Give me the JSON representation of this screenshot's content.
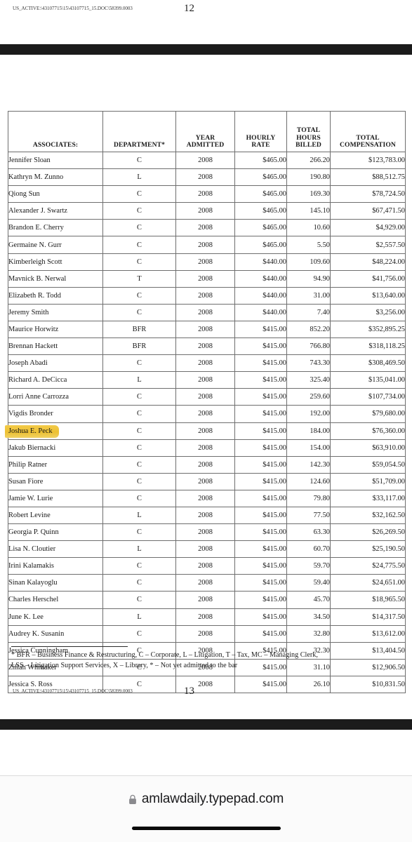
{
  "document": {
    "header_slug": "US_ACTIVE:\\43107715\\15\\43107715_15.DOC\\58399.0003",
    "header_page_number": "12",
    "footer_slug": "US_ACTIVE:\\43107715\\15\\43107715_15.DOC\\58399.0003",
    "footer_page_number": "13",
    "footnote_line1": "* BFR – Business Finance & Restructuring,  C – Corporate,  L – Litigation,  T – Tax,  MC –  Managing Clerk,",
    "footnote_line2": "LSS – Litigation Support Services,  X – Library,  * – Not yet admitted to the bar"
  },
  "table": {
    "columns": [
      {
        "key": "name",
        "label": "ASSOCIATES:",
        "lines": [
          "ASSOCIATES:"
        ]
      },
      {
        "key": "dept",
        "label": "DEPARTMENT*",
        "lines": [
          "DEPARTMENT*"
        ]
      },
      {
        "key": "year",
        "label": "YEAR ADMITTED",
        "lines": [
          "YEAR",
          "ADMITTED"
        ]
      },
      {
        "key": "rate",
        "label": "HOURLY RATE",
        "lines": [
          "HOURLY",
          "RATE"
        ]
      },
      {
        "key": "hours",
        "label": "TOTAL HOURS BILLED",
        "lines": [
          "TOTAL",
          "HOURS",
          "BILLED"
        ]
      },
      {
        "key": "comp",
        "label": "TOTAL COMPENSATION",
        "lines": [
          "TOTAL",
          "COMPENSATION"
        ]
      }
    ],
    "highlight_color": "#edc132",
    "highlighted_row_name": "Joshua E. Peck",
    "rows": [
      {
        "name": "Jennifer Sloan",
        "dept": "C",
        "year": "2008",
        "rate": "$465.00",
        "hours": "266.20",
        "comp": "$123,783.00",
        "highlight": false
      },
      {
        "name": "Kathryn M. Zunno",
        "dept": "L",
        "year": "2008",
        "rate": "$465.00",
        "hours": "190.80",
        "comp": "$88,512.75",
        "highlight": false
      },
      {
        "name": "Qiong Sun",
        "dept": "C",
        "year": "2008",
        "rate": "$465.00",
        "hours": "169.30",
        "comp": "$78,724.50",
        "highlight": false
      },
      {
        "name": "Alexander J. Swartz",
        "dept": "C",
        "year": "2008",
        "rate": "$465.00",
        "hours": "145.10",
        "comp": "$67,471.50",
        "highlight": false
      },
      {
        "name": "Brandon E. Cherry",
        "dept": "C",
        "year": "2008",
        "rate": "$465.00",
        "hours": "10.60",
        "comp": "$4,929.00",
        "highlight": false
      },
      {
        "name": "Germaine N. Gurr",
        "dept": "C",
        "year": "2008",
        "rate": "$465.00",
        "hours": "5.50",
        "comp": "$2,557.50",
        "highlight": false
      },
      {
        "name": "Kimberleigh Scott",
        "dept": "C",
        "year": "2008",
        "rate": "$440.00",
        "hours": "109.60",
        "comp": "$48,224.00",
        "highlight": false
      },
      {
        "name": "Mavnick B. Nerwal",
        "dept": "T",
        "year": "2008",
        "rate": "$440.00",
        "hours": "94.90",
        "comp": "$41,756.00",
        "highlight": false
      },
      {
        "name": "Elizabeth R. Todd",
        "dept": "C",
        "year": "2008",
        "rate": "$440.00",
        "hours": "31.00",
        "comp": "$13,640.00",
        "highlight": false
      },
      {
        "name": "Jeremy Smith",
        "dept": "C",
        "year": "2008",
        "rate": "$440.00",
        "hours": "7.40",
        "comp": "$3,256.00",
        "highlight": false
      },
      {
        "name": "Maurice Horwitz",
        "dept": "BFR",
        "year": "2008",
        "rate": "$415.00",
        "hours": "852.20",
        "comp": "$352,895.25",
        "highlight": false
      },
      {
        "name": "Brennan Hackett",
        "dept": "BFR",
        "year": "2008",
        "rate": "$415.00",
        "hours": "766.80",
        "comp": "$318,118.25",
        "highlight": false
      },
      {
        "name": "Joseph Abadi",
        "dept": "C",
        "year": "2008",
        "rate": "$415.00",
        "hours": "743.30",
        "comp": "$308,469.50",
        "highlight": false
      },
      {
        "name": "Richard A. DeCicca",
        "dept": "L",
        "year": "2008",
        "rate": "$415.00",
        "hours": "325.40",
        "comp": "$135,041.00",
        "highlight": false
      },
      {
        "name": "Lorri Anne Carrozza",
        "dept": "C",
        "year": "2008",
        "rate": "$415.00",
        "hours": "259.60",
        "comp": "$107,734.00",
        "highlight": false
      },
      {
        "name": "Vigdis Bronder",
        "dept": "C",
        "year": "2008",
        "rate": "$415.00",
        "hours": "192.00",
        "comp": "$79,680.00",
        "highlight": false
      },
      {
        "name": "Joshua E. Peck",
        "dept": "C",
        "year": "2008",
        "rate": "$415.00",
        "hours": "184.00",
        "comp": "$76,360.00",
        "highlight": true
      },
      {
        "name": "Jakub Biernacki",
        "dept": "C",
        "year": "2008",
        "rate": "$415.00",
        "hours": "154.00",
        "comp": "$63,910.00",
        "highlight": false
      },
      {
        "name": "Philip Ratner",
        "dept": "C",
        "year": "2008",
        "rate": "$415.00",
        "hours": "142.30",
        "comp": "$59,054.50",
        "highlight": false
      },
      {
        "name": "Susan Fiore",
        "dept": "C",
        "year": "2008",
        "rate": "$415.00",
        "hours": "124.60",
        "comp": "$51,709.00",
        "highlight": false
      },
      {
        "name": "Jamie W. Lurie",
        "dept": "C",
        "year": "2008",
        "rate": "$415.00",
        "hours": "79.80",
        "comp": "$33,117.00",
        "highlight": false
      },
      {
        "name": "Robert Levine",
        "dept": "L",
        "year": "2008",
        "rate": "$415.00",
        "hours": "77.50",
        "comp": "$32,162.50",
        "highlight": false
      },
      {
        "name": "Georgia P. Quinn",
        "dept": "C",
        "year": "2008",
        "rate": "$415.00",
        "hours": "63.30",
        "comp": "$26,269.50",
        "highlight": false
      },
      {
        "name": "Lisa N. Cloutier",
        "dept": "L",
        "year": "2008",
        "rate": "$415.00",
        "hours": "60.70",
        "comp": "$25,190.50",
        "highlight": false
      },
      {
        "name": "Irini Kalamakis",
        "dept": "C",
        "year": "2008",
        "rate": "$415.00",
        "hours": "59.70",
        "comp": "$24,775.50",
        "highlight": false
      },
      {
        "name": "Sinan Kalayoglu",
        "dept": "C",
        "year": "2008",
        "rate": "$415.00",
        "hours": "59.40",
        "comp": "$24,651.00",
        "highlight": false
      },
      {
        "name": "Charles Herschel",
        "dept": "C",
        "year": "2008",
        "rate": "$415.00",
        "hours": "45.70",
        "comp": "$18,965.50",
        "highlight": false
      },
      {
        "name": "June K. Lee",
        "dept": "L",
        "year": "2008",
        "rate": "$415.00",
        "hours": "34.50",
        "comp": "$14,317.50",
        "highlight": false
      },
      {
        "name": "Audrey K. Susanin",
        "dept": "C",
        "year": "2008",
        "rate": "$415.00",
        "hours": "32.80",
        "comp": "$13,612.00",
        "highlight": false
      },
      {
        "name": "Jessica Cunningham",
        "dept": "C",
        "year": "2008",
        "rate": "$415.00",
        "hours": "32.30",
        "comp": "$13,404.50",
        "highlight": false
      },
      {
        "name": "Zillah Whittaker",
        "dept": "C",
        "year": "2008",
        "rate": "$415.00",
        "hours": "31.10",
        "comp": "$12,906.50",
        "highlight": false
      },
      {
        "name": "Jessica S. Ross",
        "dept": "C",
        "year": "2008",
        "rate": "$415.00",
        "hours": "26.10",
        "comp": "$10,831.50",
        "highlight": false
      }
    ]
  },
  "browser": {
    "url": "amlawdaily.typepad.com",
    "lock_icon": "lock-icon",
    "secure": true
  }
}
